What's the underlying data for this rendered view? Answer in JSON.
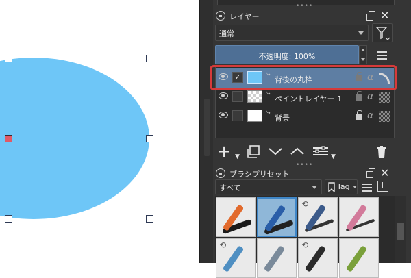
{
  "layers_panel": {
    "title": "レイヤー",
    "blend_mode": "通常",
    "opacity_label": "不透明度: 100%",
    "layers": [
      {
        "name": "背後の丸枠",
        "selected": true,
        "checked": "✓"
      },
      {
        "name": "ペイントレイヤー 1",
        "selected": false,
        "checked": ""
      },
      {
        "name": "背景",
        "selected": false,
        "checked": ""
      }
    ]
  },
  "brush_panel": {
    "title": "ブラシプリセット",
    "filter_value": "すべて",
    "tag_label": "Tag"
  },
  "colors": {
    "shape_fill": "#6ec6f7",
    "selected_row": "#5e7ea3",
    "highlight_border": "#d63a3a",
    "active_handle": "#e05a67"
  },
  "icons": {
    "lock": "lock-icon",
    "filter": "filter-icon",
    "eye": "eye-icon",
    "alpha": "α",
    "add": "+",
    "delete": "trash-icon"
  }
}
